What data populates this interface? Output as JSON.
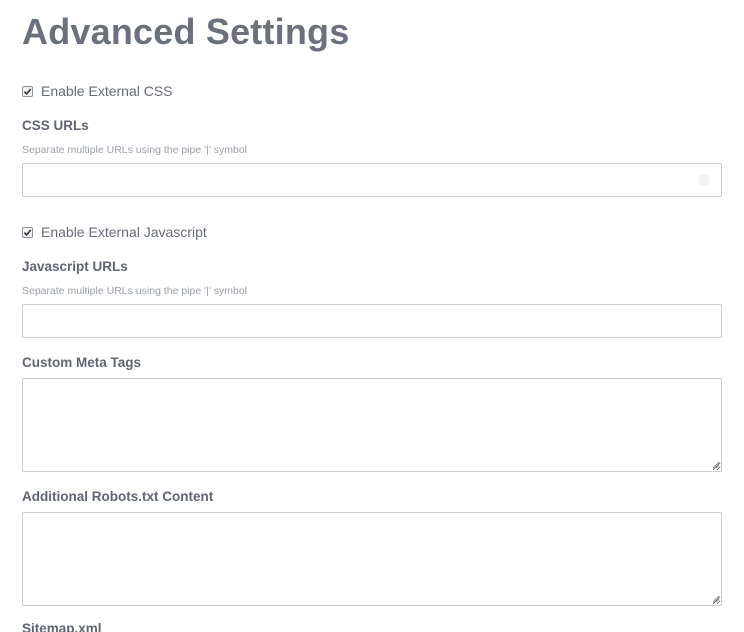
{
  "page": {
    "title": "Advanced Settings"
  },
  "external_css": {
    "checkbox_label": "Enable External CSS",
    "checked": true,
    "field_label": "CSS URLs",
    "hint": "Separate multiple URLs using the pipe '|' symbol",
    "value": "",
    "placeholder": ""
  },
  "external_js": {
    "checkbox_label": "Enable External Javascript",
    "checked": true,
    "field_label": "Javascript URLs",
    "hint": "Separate multiple URLs using the pipe '|' symbol",
    "value": "",
    "placeholder": ""
  },
  "meta_tags": {
    "field_label": "Custom Meta Tags",
    "value": ""
  },
  "robots": {
    "field_label": "Additional Robots.txt Content",
    "value": ""
  },
  "sitemap": {
    "field_label": "Sitemap.xml"
  },
  "colors": {
    "text": "#5d6470",
    "title": "#6b717c",
    "hint": "#9aa0a8",
    "border": "#c9ccd1"
  }
}
